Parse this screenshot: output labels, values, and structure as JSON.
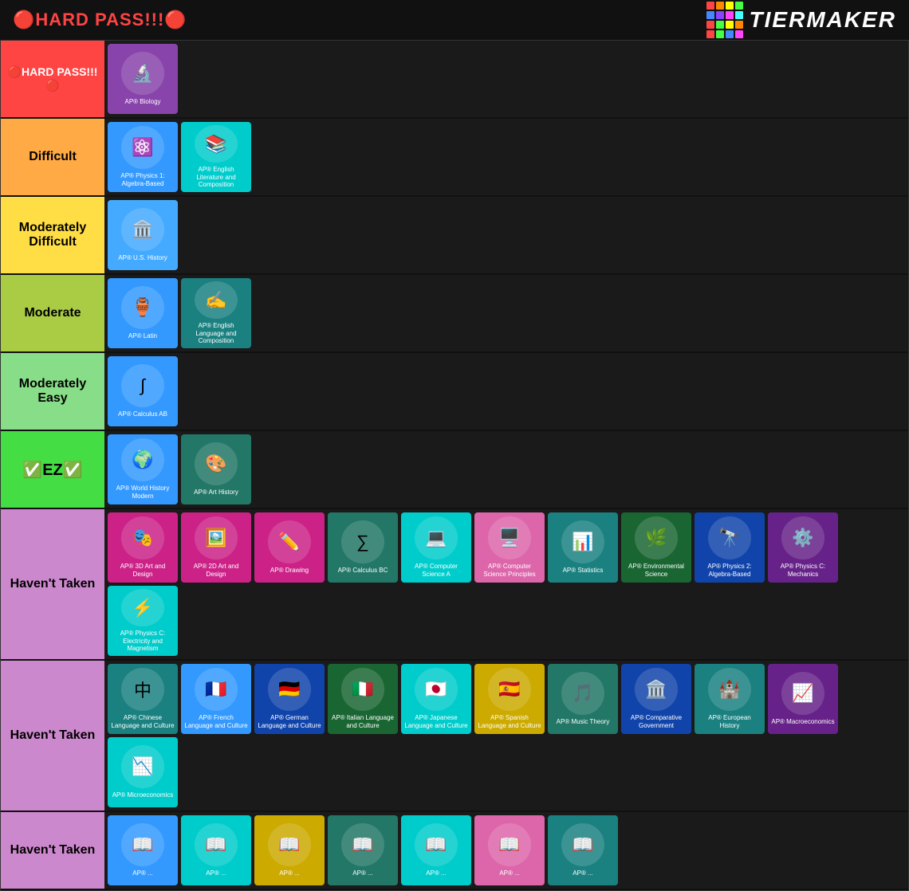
{
  "header": {
    "title": "🔴HARD PASS!!!🔴",
    "logo_text": "TiERMAKER",
    "logo_colors": [
      "#ff4444",
      "#ff8800",
      "#ffff00",
      "#44ff44",
      "#4488ff",
      "#8844ff",
      "#ff44ff",
      "#44ffff",
      "#ff4444",
      "#44ff44",
      "#ffff00",
      "#ff8800",
      "#ff4444",
      "#44ff44",
      "#4488ff",
      "#ff44ff"
    ]
  },
  "tiers": [
    {
      "id": "hard",
      "label": "🔴HARD PASS!!!🔴",
      "label_class": "row-hard",
      "items": [
        {
          "label": "AP® Biology",
          "bg": "bg-purple",
          "icon": "🔬"
        }
      ]
    },
    {
      "id": "difficult",
      "label": "Difficult",
      "label_class": "row-difficult",
      "items": [
        {
          "label": "AP® Physics 1: Algebra-Based",
          "bg": "bg-blue",
          "icon": "⚛️"
        },
        {
          "label": "AP® English Literature and Composition",
          "bg": "bg-cyan",
          "icon": "📚"
        }
      ]
    },
    {
      "id": "mod-difficult",
      "label": "Moderately Difficult",
      "label_class": "row-mod-difficult",
      "items": [
        {
          "label": "AP® U.S. History",
          "bg": "bg-light-blue",
          "icon": "🏛️"
        }
      ]
    },
    {
      "id": "moderate",
      "label": "Moderate",
      "label_class": "row-moderate",
      "items": [
        {
          "label": "AP® Latin",
          "bg": "bg-blue",
          "icon": "🏺"
        },
        {
          "label": "AP® English Language and Composition",
          "bg": "bg-teal",
          "icon": "✍️"
        }
      ]
    },
    {
      "id": "mod-easy",
      "label": "Moderately Easy",
      "label_class": "row-mod-easy",
      "items": [
        {
          "label": "AP® Calculus AB",
          "bg": "bg-blue",
          "icon": "∫"
        }
      ]
    },
    {
      "id": "ez",
      "label": "✅EZ✅",
      "label_class": "row-ez",
      "items": [
        {
          "label": "AP® World History Modern",
          "bg": "bg-blue",
          "icon": "🌍"
        },
        {
          "label": "AP® Art History",
          "bg": "bg-teal2",
          "icon": "🎨"
        }
      ]
    },
    {
      "id": "havent-taken",
      "label": "Haven't Taken",
      "label_class": "row-havent-taken",
      "items": [
        {
          "label": "AP® 3D Art and Design",
          "bg": "bg-magenta",
          "icon": "🎭"
        },
        {
          "label": "AP® 2D Art and Design",
          "bg": "bg-magenta",
          "icon": "🖼️"
        },
        {
          "label": "AP® Drawing",
          "bg": "bg-magenta",
          "icon": "✏️"
        },
        {
          "label": "AP® Calculus BC",
          "bg": "bg-teal2",
          "icon": "∑"
        },
        {
          "label": "AP® Computer Science A",
          "bg": "bg-cyan",
          "icon": "💻"
        },
        {
          "label": "AP® Computer Science Principles",
          "bg": "bg-pink",
          "icon": "🖥️"
        },
        {
          "label": "AP® Statistics",
          "bg": "bg-teal",
          "icon": "📊"
        },
        {
          "label": "AP® Environmental Science",
          "bg": "bg-dark-green",
          "icon": "🌿"
        },
        {
          "label": "AP® Physics 2: Algebra-Based",
          "bg": "bg-dark-blue",
          "icon": "🔭"
        },
        {
          "label": "AP® Physics C: Mechanics",
          "bg": "bg-dark-purple",
          "icon": "⚙️"
        },
        {
          "label": "AP® Physics C: Electricity and Magnetism",
          "bg": "bg-cyan",
          "icon": "⚡"
        }
      ]
    },
    {
      "id": "havent-taken2",
      "label": "Haven't Taken",
      "label_class": "row-havent-taken",
      "items": [
        {
          "label": "AP® Chinese Language and Culture",
          "bg": "bg-teal",
          "icon": "中"
        },
        {
          "label": "AP® French Language and Culture",
          "bg": "bg-blue",
          "icon": "🇫🇷"
        },
        {
          "label": "AP® German Language and Culture",
          "bg": "bg-dark-blue",
          "icon": "🇩🇪"
        },
        {
          "label": "AP® Italian Language and Culture",
          "bg": "bg-dark-green",
          "icon": "🇮🇹"
        },
        {
          "label": "AP® Japanese Language and Culture",
          "bg": "bg-cyan",
          "icon": "🇯🇵"
        },
        {
          "label": "AP® Spanish Language and Culture",
          "bg": "bg-gold",
          "icon": "🇪🇸"
        },
        {
          "label": "AP® Music Theory",
          "bg": "bg-teal2",
          "icon": "🎵"
        },
        {
          "label": "AP® Comparative Government",
          "bg": "bg-dark-blue",
          "icon": "🏛️"
        },
        {
          "label": "AP® European History",
          "bg": "bg-teal",
          "icon": "🏰"
        },
        {
          "label": "AP® Macroeconomics",
          "bg": "bg-dark-purple",
          "icon": "📈"
        },
        {
          "label": "AP® Microeconomics",
          "bg": "bg-cyan",
          "icon": "📉"
        }
      ]
    },
    {
      "id": "bottom",
      "label": "Haven't Taken",
      "label_class": "row-bottom",
      "items": [
        {
          "label": "AP® ...",
          "bg": "bg-blue",
          "icon": "📖"
        },
        {
          "label": "AP® ...",
          "bg": "bg-cyan",
          "icon": "📖"
        },
        {
          "label": "AP® ...",
          "bg": "bg-gold",
          "icon": "📖"
        },
        {
          "label": "AP® ...",
          "bg": "bg-teal2",
          "icon": "📖"
        },
        {
          "label": "AP® ...",
          "bg": "bg-cyan",
          "icon": "📖"
        },
        {
          "label": "AP® ...",
          "bg": "bg-pink",
          "icon": "📖"
        },
        {
          "label": "AP® ...",
          "bg": "bg-teal",
          "icon": "📖"
        }
      ]
    }
  ]
}
